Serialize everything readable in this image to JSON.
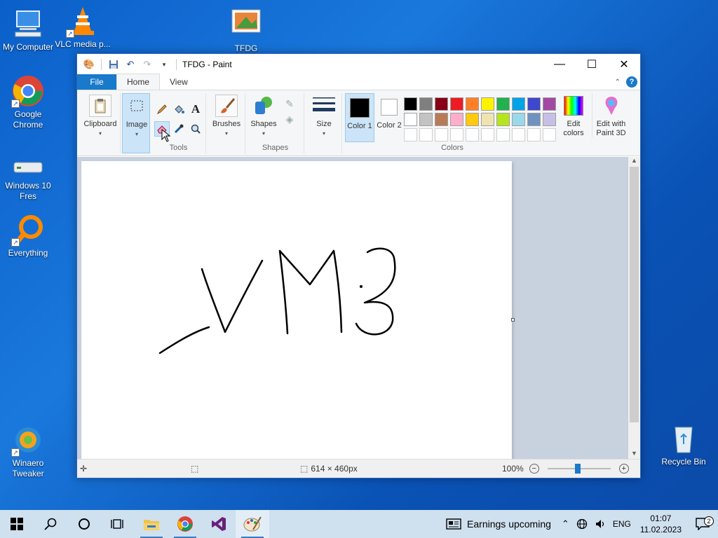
{
  "desktop": {
    "icons": [
      {
        "label": "My Computer"
      },
      {
        "label": "VLC media p..."
      },
      {
        "label": "TFDG"
      },
      {
        "label": "Google Chrome"
      },
      {
        "label": "Windows 10 Fres"
      },
      {
        "label": "Everything"
      },
      {
        "label": "Winaero Tweaker"
      },
      {
        "label": "Recycle Bin"
      }
    ]
  },
  "window": {
    "title": "TFDG - Paint",
    "tabs": [
      "File",
      "Home",
      "View"
    ],
    "ribbon": {
      "clipboard": "Clipboard",
      "image": "Image",
      "tools_group": "Tools",
      "brushes": "Brushes",
      "shapes": "Shapes",
      "shapes_group": "Shapes",
      "size": "Size",
      "color1": "Color 1",
      "color2": "Color 2",
      "edit_colors": "Edit colors",
      "paint3d": "Edit with Paint 3D",
      "colors_group": "Colors"
    },
    "palette": {
      "row1": [
        "#000000",
        "#7f7f7f",
        "#880015",
        "#ed1c24",
        "#ff7f27",
        "#fff200",
        "#22b14c",
        "#00a2e8",
        "#3f48cc",
        "#a349a4"
      ],
      "row2": [
        "#ffffff",
        "#c3c3c3",
        "#b97a57",
        "#ffaec9",
        "#ffc90e",
        "#efe4b0",
        "#b5e61d",
        "#99d9ea",
        "#7092be",
        "#c8bfe7"
      ]
    },
    "status": {
      "size": "614 × 460px",
      "zoom": "100%"
    }
  },
  "taskbar": {
    "news": "Earnings upcoming",
    "lang": "ENG",
    "time": "01:07",
    "date": "11.02.2023",
    "notifications": "2"
  }
}
